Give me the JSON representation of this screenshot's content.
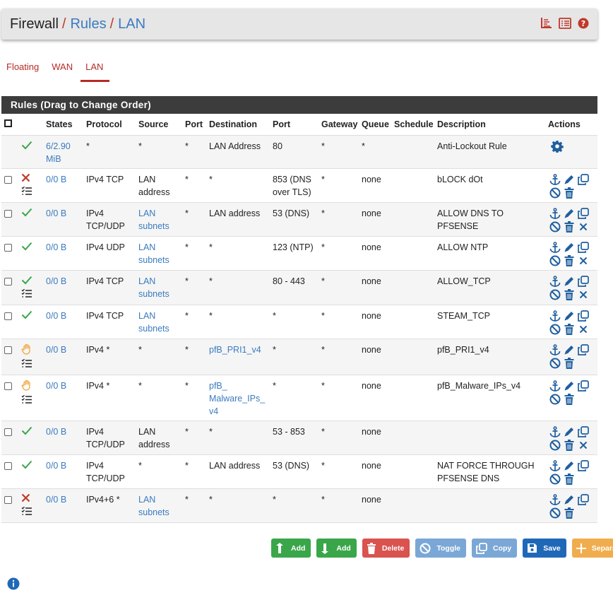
{
  "breadcrumb": {
    "root": "Firewall",
    "sep": "/",
    "rules": "Rules",
    "lan": "LAN"
  },
  "tabs": [
    {
      "label": "Floating"
    },
    {
      "label": "WAN"
    },
    {
      "label": "LAN",
      "active": true
    }
  ],
  "panel_title": "Rules (Drag to Change Order)",
  "columns": {
    "states": "States",
    "protocol": "Protocol",
    "source": "Source",
    "port": "Port",
    "destination": "Destination",
    "dport": "Port",
    "gateway": "Gateway",
    "queue": "Queue",
    "schedule": "Schedule",
    "description": "Description",
    "actions": "Actions"
  },
  "rows": [
    {
      "status": "pass",
      "states": "6/2.90 MiB",
      "protocol": "*",
      "source": "*",
      "port": "*",
      "destination": "LAN Address",
      "dport": "80",
      "gateway": "*",
      "queue": "*",
      "schedule": "",
      "description": "Anti-Lockout Rule"
    },
    {
      "status": "block",
      "states": "0/0 B",
      "protocol": "IPv4 TCP",
      "source": "LAN address",
      "port": "*",
      "destination": "*",
      "dport": "853 (DNS over TLS)",
      "gateway": "*",
      "queue": "none",
      "schedule": "",
      "description": "bLOCK dOt"
    },
    {
      "status": "pass",
      "states": "0/0 B",
      "protocol": "IPv4 TCP/UDP",
      "source": "LAN subnets",
      "port": "*",
      "destination": "LAN address",
      "dport": "53 (DNS)",
      "gateway": "*",
      "queue": "none",
      "schedule": "",
      "description": "ALLOW DNS TO PFSENSE"
    },
    {
      "status": "pass",
      "states": "0/0 B",
      "protocol": "IPv4 UDP",
      "source": "LAN subnets",
      "port": "*",
      "destination": "*",
      "dport": "123 (NTP)",
      "gateway": "*",
      "queue": "none",
      "schedule": "",
      "description": "ALLOW NTP"
    },
    {
      "status": "pass",
      "states": "0/0 B",
      "protocol": "IPv4 TCP",
      "source": "LAN subnets",
      "port": "*",
      "destination": "*",
      "dport": "80 - 443",
      "gateway": "*",
      "queue": "none",
      "schedule": "",
      "description": "ALLOW_TCP"
    },
    {
      "status": "pass",
      "states": "0/0 B",
      "protocol": "IPv4 TCP",
      "source": "LAN subnets",
      "port": "*",
      "destination": "*",
      "dport": "*",
      "gateway": "*",
      "queue": "none",
      "schedule": "",
      "description": "STEAM_TCP"
    },
    {
      "status": "match",
      "states": "0/0 B",
      "protocol": "IPv4 *",
      "source": "*",
      "port": "*",
      "destination": "pfB_PRI1_v4",
      "dport": "*",
      "gateway": "*",
      "queue": "none",
      "schedule": "",
      "description": "pfB_PRI1_v4"
    },
    {
      "status": "match",
      "states": "0/0 B",
      "protocol": "IPv4 *",
      "source": "*",
      "port": "*",
      "destination": "pfB_ Malware_IPs_ v4",
      "dport": "*",
      "gateway": "*",
      "queue": "none",
      "schedule": "",
      "description": "pfB_Malware_IPs_v4"
    },
    {
      "status": "pass",
      "states": "0/0 B",
      "protocol": "IPv4 TCP/UDP",
      "source": "LAN address",
      "port": "*",
      "destination": "*",
      "dport": "53 - 853",
      "gateway": "*",
      "queue": "none",
      "schedule": "",
      "description": ""
    },
    {
      "status": "pass",
      "states": "0/0 B",
      "protocol": "IPv4 TCP/UDP",
      "source": "*",
      "port": "*",
      "destination": "LAN address",
      "dport": "53 (DNS)",
      "gateway": "*",
      "queue": "none",
      "schedule": "",
      "description": "NAT FORCE THROUGH PFSENSE DNS"
    },
    {
      "status": "block",
      "states": "0/0 B",
      "protocol": "IPv4+6 *",
      "source": "LAN subnets",
      "port": "*",
      "destination": "*",
      "dport": "*",
      "gateway": "*",
      "queue": "none",
      "schedule": "",
      "description": ""
    }
  ],
  "buttons": {
    "add_top": "Add",
    "add_bottom": "Add",
    "delete": "Delete",
    "toggle": "Toggle",
    "copy": "Copy",
    "save": "Save",
    "separator": "Separator"
  },
  "colors": {
    "pass": "#3aa64a",
    "block": "#c0392b",
    "match": "#f0ad4e",
    "link": "#3a7bbf",
    "action": "#1f5f9f"
  }
}
